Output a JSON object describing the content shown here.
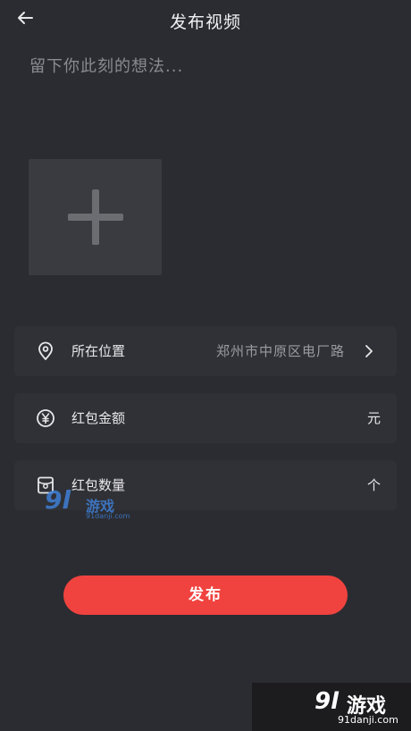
{
  "header": {
    "back_icon": "arrow-left-icon",
    "title": "发布视频"
  },
  "caption": {
    "placeholder": "留下你此刻的想法..."
  },
  "media": {
    "add_icon": "plus-icon"
  },
  "form": {
    "location": {
      "icon": "location-pin-icon",
      "label": "所在位置",
      "value": "郑州市中原区电厂路",
      "chevron_icon": "chevron-right-icon"
    },
    "amount": {
      "icon": "yen-circle-icon",
      "label": "红包金额",
      "unit": "元"
    },
    "count": {
      "icon": "red-packet-icon",
      "label": "红包数量",
      "unit": "个"
    }
  },
  "actions": {
    "publish_label": "发布"
  },
  "watermarks": {
    "middle": {
      "num": "9l",
      "cn": "游戏",
      "url": "91danji.com"
    },
    "corner": {
      "num": "9l",
      "cn": "游戏",
      "url": "91danji.com"
    }
  },
  "colors": {
    "background": "#2b2c31",
    "row_background": "#303136",
    "accent": "#f0433f"
  }
}
